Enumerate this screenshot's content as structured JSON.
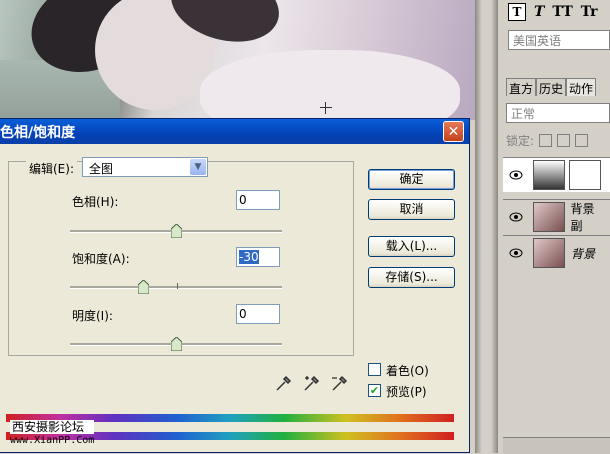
{
  "canvas": {
    "description_icon": "crosshair-icon"
  },
  "right_panel": {
    "text_tools": [
      "T",
      "T",
      "TT",
      "Tr"
    ],
    "font_family": "美国英语",
    "tabs": [
      "直方",
      "历史",
      "动作"
    ],
    "blend_mode": "正常",
    "lock_label": "锁定:",
    "layers": [
      {
        "name": "",
        "selected": true
      },
      {
        "name": "背景 副",
        "selected": false
      },
      {
        "name": "背景",
        "selected": false
      }
    ]
  },
  "dialog": {
    "title": "色相/饱和度",
    "close_label": "✕",
    "edit_label": "编辑(E):",
    "edit_value": "全图",
    "hue_label": "色相(H):",
    "hue_value": "0",
    "saturation_label": "饱和度(A):",
    "saturation_value": "-30",
    "lightness_label": "明度(I):",
    "lightness_value": "0",
    "buttons": {
      "ok": "确定",
      "cancel": "取消",
      "load": "载入(L)...",
      "save": "存储(S)..."
    },
    "colorize_label": "着色(O)",
    "colorize_checked": false,
    "preview_label": "预览(P)",
    "preview_checked": true
  },
  "watermark": {
    "line1": "西安摄影论坛",
    "line2": "www.XianPP.Com"
  }
}
